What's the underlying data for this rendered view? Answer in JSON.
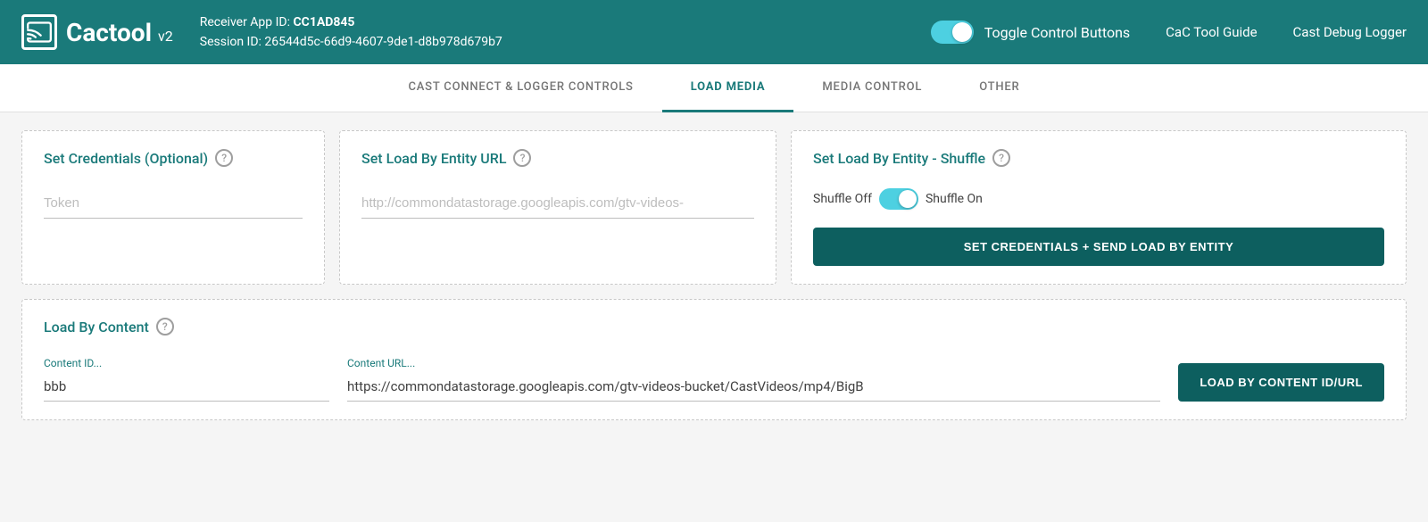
{
  "header": {
    "logo_text": "Cactool",
    "logo_version": "v2",
    "receiver_app_label": "Receiver App ID:",
    "receiver_app_id": "CC1AD845",
    "session_label": "Session ID:",
    "session_id": "26544d5c-66d9-4607-9de1-d8b978d679b7",
    "toggle_label": "Toggle Control Buttons",
    "link_guide": "CaC Tool Guide",
    "link_logger": "Cast Debug Logger"
  },
  "tabs": [
    {
      "label": "CAST CONNECT & LOGGER CONTROLS",
      "active": false
    },
    {
      "label": "LOAD MEDIA",
      "active": true
    },
    {
      "label": "MEDIA CONTROL",
      "active": false
    },
    {
      "label": "OTHER",
      "active": false
    }
  ],
  "load_media": {
    "credentials_card": {
      "title": "Set Credentials (Optional)",
      "token_placeholder": "Token"
    },
    "entity_url_card": {
      "title": "Set Load By Entity URL",
      "url_placeholder": "http://commondatastorage.googleapis.com/gtv-videos-"
    },
    "entity_shuffle_card": {
      "title": "Set Load By Entity - Shuffle",
      "shuffle_off_label": "Shuffle Off",
      "shuffle_on_label": "Shuffle On",
      "button_label": "SET CREDENTIALS + SEND LOAD BY ENTITY"
    },
    "load_content_card": {
      "title": "Load By Content",
      "content_id_label": "Content ID...",
      "content_id_value": "bbb",
      "content_url_label": "Content URL...",
      "content_url_value": "https://commondatastorage.googleapis.com/gtv-videos-bucket/CastVideos/mp4/BigB",
      "button_label": "LOAD BY CONTENT ID/URL"
    }
  }
}
